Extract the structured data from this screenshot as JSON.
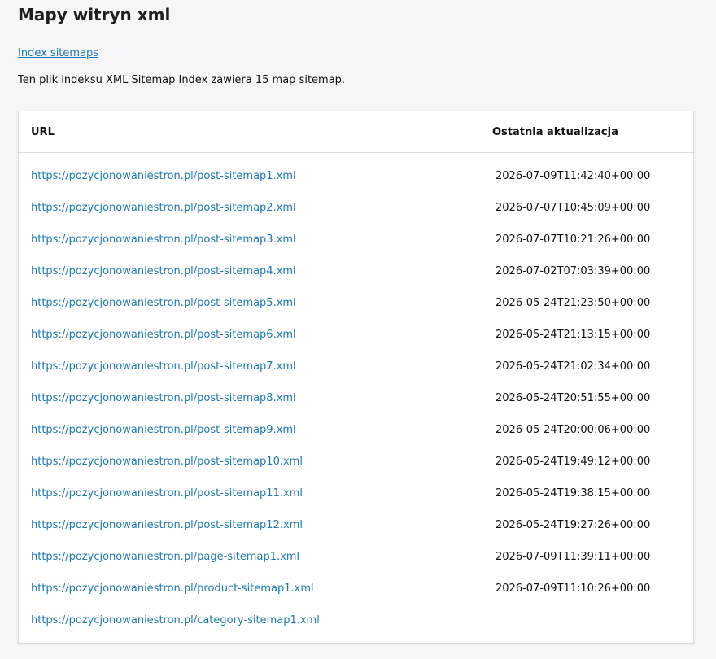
{
  "page": {
    "title": "Mapy witryn xml",
    "index_link": "Index sitemaps",
    "description": "Ten plik indeksu XML Sitemap Index zawiera 15 map sitemap."
  },
  "table": {
    "headers": {
      "url": "URL",
      "last_modified": "Ostatnia aktualizacja"
    },
    "rows": [
      {
        "url": "https://pozycjonowaniestron.pl/post-sitemap1.xml",
        "date": "2026-07-09T11:42:40+00:00"
      },
      {
        "url": "https://pozycjonowaniestron.pl/post-sitemap2.xml",
        "date": "2026-07-07T10:45:09+00:00"
      },
      {
        "url": "https://pozycjonowaniestron.pl/post-sitemap3.xml",
        "date": "2026-07-07T10:21:26+00:00"
      },
      {
        "url": "https://pozycjonowaniestron.pl/post-sitemap4.xml",
        "date": "2026-07-02T07:03:39+00:00"
      },
      {
        "url": "https://pozycjonowaniestron.pl/post-sitemap5.xml",
        "date": "2026-05-24T21:23:50+00:00"
      },
      {
        "url": "https://pozycjonowaniestron.pl/post-sitemap6.xml",
        "date": "2026-05-24T21:13:15+00:00"
      },
      {
        "url": "https://pozycjonowaniestron.pl/post-sitemap7.xml",
        "date": "2026-05-24T21:02:34+00:00"
      },
      {
        "url": "https://pozycjonowaniestron.pl/post-sitemap8.xml",
        "date": "2026-05-24T20:51:55+00:00"
      },
      {
        "url": "https://pozycjonowaniestron.pl/post-sitemap9.xml",
        "date": "2026-05-24T20:00:06+00:00"
      },
      {
        "url": "https://pozycjonowaniestron.pl/post-sitemap10.xml",
        "date": "2026-05-24T19:49:12+00:00"
      },
      {
        "url": "https://pozycjonowaniestron.pl/post-sitemap11.xml",
        "date": "2026-05-24T19:38:15+00:00"
      },
      {
        "url": "https://pozycjonowaniestron.pl/post-sitemap12.xml",
        "date": "2026-05-24T19:27:26+00:00"
      },
      {
        "url": "https://pozycjonowaniestron.pl/page-sitemap1.xml",
        "date": "2026-07-09T11:39:11+00:00"
      },
      {
        "url": "https://pozycjonowaniestron.pl/product-sitemap1.xml",
        "date": "2026-07-09T11:10:26+00:00"
      },
      {
        "url": "https://pozycjonowaniestron.pl/category-sitemap1.xml",
        "date": ""
      }
    ]
  },
  "colors": {
    "link": "#1e79b0",
    "background": "#f6f5f7",
    "card": "#ffffff"
  }
}
